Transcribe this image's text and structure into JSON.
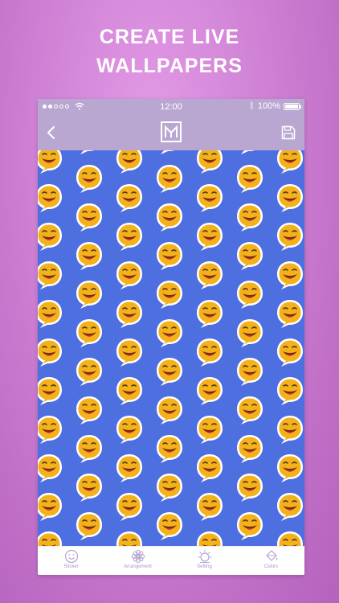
{
  "headline": {
    "line1": "CREATE LIVE",
    "line2": "WALLPAPERS"
  },
  "status_bar": {
    "time": "12:00",
    "battery": "100%"
  },
  "nav": {
    "logo_icon": "monogram-logo-icon",
    "back_icon": "chevron-left-icon",
    "save_icon": "floppy-save-icon"
  },
  "wallpaper": {
    "background_color": "#4e6fe0",
    "pattern_icon": "smiling-speech-bubble-emoji"
  },
  "tabs": [
    {
      "label": "Sticker",
      "icon": "smiley-icon"
    },
    {
      "label": "Arrangement",
      "icon": "flower-grid-icon"
    },
    {
      "label": "Setting",
      "icon": "sun-gear-icon"
    },
    {
      "label": "Colors",
      "icon": "paint-bucket-icon"
    }
  ],
  "colors": {
    "accent": "#b9a7d2",
    "tab_text": "#a896c6",
    "background": "#c97fd0"
  }
}
